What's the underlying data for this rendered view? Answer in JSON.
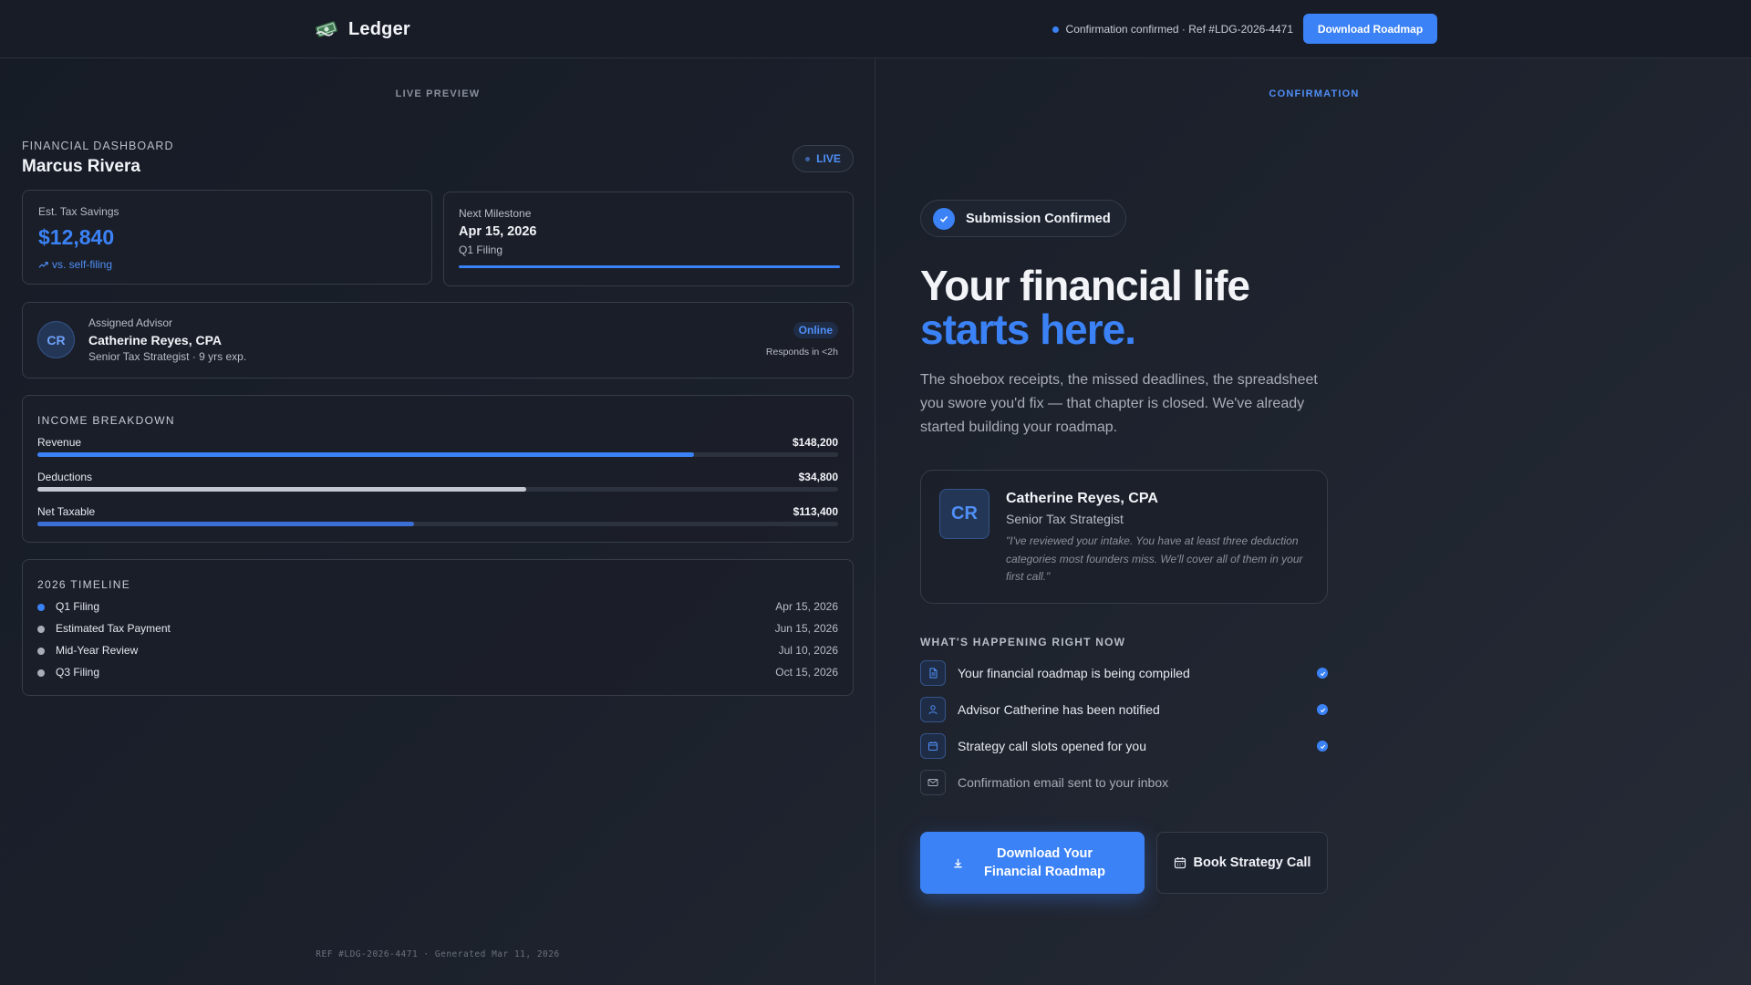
{
  "header": {
    "brand": "Ledger",
    "status_text": "Confirmation confirmed · Ref #LDG-2026-4471",
    "download_label": "Download Roadmap"
  },
  "preview": {
    "eyebrow": "LIVE PREVIEW",
    "dashboard_label": "FINANCIAL DASHBOARD",
    "user_name": "Marcus Rivera",
    "live_label": "LIVE",
    "tax_savings": {
      "label": "Est. Tax Savings",
      "value": "$12,840",
      "trend": "vs. self-filing"
    },
    "milestone": {
      "label": "Next Milestone",
      "date": "Apr 15, 2026",
      "name": "Q1 Filing",
      "progress": 1.0
    },
    "advisor": {
      "initials": "CR",
      "label": "Assigned Advisor",
      "name": "Catherine Reyes, CPA",
      "role": "Senior Tax Strategist · 9 yrs exp.",
      "status": "Online",
      "response": "Responds in <2h"
    },
    "income": {
      "title": "INCOME BREAKDOWN",
      "rows": [
        {
          "name": "Revenue",
          "value": "$148,200",
          "share": 0.82,
          "color": "#3b82f6"
        },
        {
          "name": "Deductions",
          "value": "$34,800",
          "share": 0.61,
          "color": "#c4c8d0"
        },
        {
          "name": "Net Taxable",
          "value": "$113,400",
          "share": 0.47,
          "color": "#3b6fd6"
        }
      ]
    },
    "timeline": {
      "title": "2026 TIMELINE",
      "items": [
        {
          "name": "Q1 Filing",
          "date": "Apr 15, 2026",
          "active": true
        },
        {
          "name": "Estimated Tax Payment",
          "date": "Jun 15, 2026",
          "active": false
        },
        {
          "name": "Mid-Year Review",
          "date": "Jul 10, 2026",
          "active": false
        },
        {
          "name": "Q3 Filing",
          "date": "Oct 15, 2026",
          "active": false
        }
      ]
    },
    "footer": "REF #LDG-2026-4471 · Generated Mar 11, 2026"
  },
  "confirmation": {
    "eyebrow": "CONFIRMATION",
    "pill": "Submission Confirmed",
    "hero_line1": "Your financial life",
    "hero_line2": "starts here.",
    "lede": "The shoebox receipts, the missed deadlines, the spreadsheet you swore you'd fix — that chapter is closed. We've already started building your roadmap.",
    "advisor": {
      "initials": "CR",
      "name": "Catherine Reyes, CPA",
      "role": "Senior Tax Strategist",
      "quote": "\"I've reviewed your intake. You have at least three deduction categories most founders miss. We'll cover all of them in your first call.\""
    },
    "happening": {
      "title": "WHAT'S HAPPENING RIGHT NOW",
      "items": [
        {
          "text": "Your financial roadmap is being compiled",
          "icon": "document-icon",
          "done": true
        },
        {
          "text": "Advisor Catherine has been notified",
          "icon": "user-icon",
          "done": true
        },
        {
          "text": "Strategy call slots opened for you",
          "icon": "calendar-icon",
          "done": true
        },
        {
          "text": "Confirmation email sent to your inbox",
          "icon": "mail-icon",
          "done": false
        }
      ]
    },
    "primary_cta": "Download Your Financial Roadmap",
    "secondary_cta": "Book Strategy Call"
  }
}
